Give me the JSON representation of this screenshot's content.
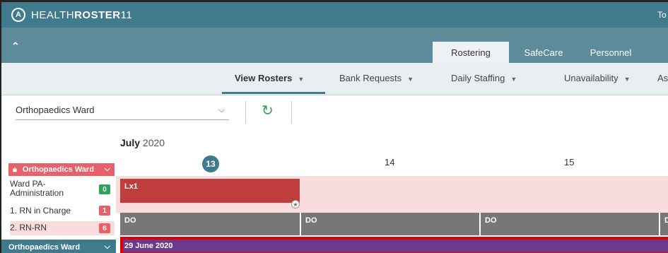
{
  "app": {
    "logo_mark": "A",
    "title_light": "HEALTH",
    "title_bold": "ROSTER",
    "title_version": "11",
    "topbar_right_text": "To"
  },
  "modules": {
    "tabs": [
      {
        "label": "Rostering",
        "active": true
      },
      {
        "label": "SafeCare",
        "active": false
      },
      {
        "label": "Personnel",
        "active": false
      }
    ]
  },
  "menu": {
    "items": [
      {
        "label": "View Rosters",
        "active": true
      },
      {
        "label": "Bank Requests",
        "active": false
      },
      {
        "label": "Daily Staffing",
        "active": false
      },
      {
        "label": "Unavailability",
        "active": false
      },
      {
        "label": "As",
        "active": false
      }
    ]
  },
  "toolbar": {
    "ward_select_value": "Orthopaedics Ward"
  },
  "calendar": {
    "month": "July",
    "year": "2020",
    "days": [
      "13",
      "14",
      "15"
    ],
    "today": "13"
  },
  "sidebar": {
    "ward_name": "Orthopaedics Ward",
    "roles": [
      {
        "label": "Ward PA-Administration",
        "line1": "Ward PA-",
        "line2": "Administration",
        "count": "0",
        "color": "#2fa35a"
      },
      {
        "label": "1. RN in Charge",
        "count": "1",
        "color": "#e8606a"
      },
      {
        "label": "2. RN-RN",
        "count": "6",
        "color": "#e8606a"
      }
    ],
    "footer_ward": "Orthopaedics Ward"
  },
  "shifts": {
    "main_shift": "Lx1",
    "do_label": "DO",
    "do_cells": [
      "DO",
      "DO",
      "DO",
      "D"
    ]
  },
  "date_bar": {
    "label": "29 June 2020"
  },
  "colors": {
    "header": "#3f7a8d",
    "subheader": "#5d8b9a",
    "accent_red": "#c03d3d",
    "pink_row": "#f9dcdc",
    "purple_bar": "#6b3a8e",
    "highlight_border": "#e00000"
  }
}
